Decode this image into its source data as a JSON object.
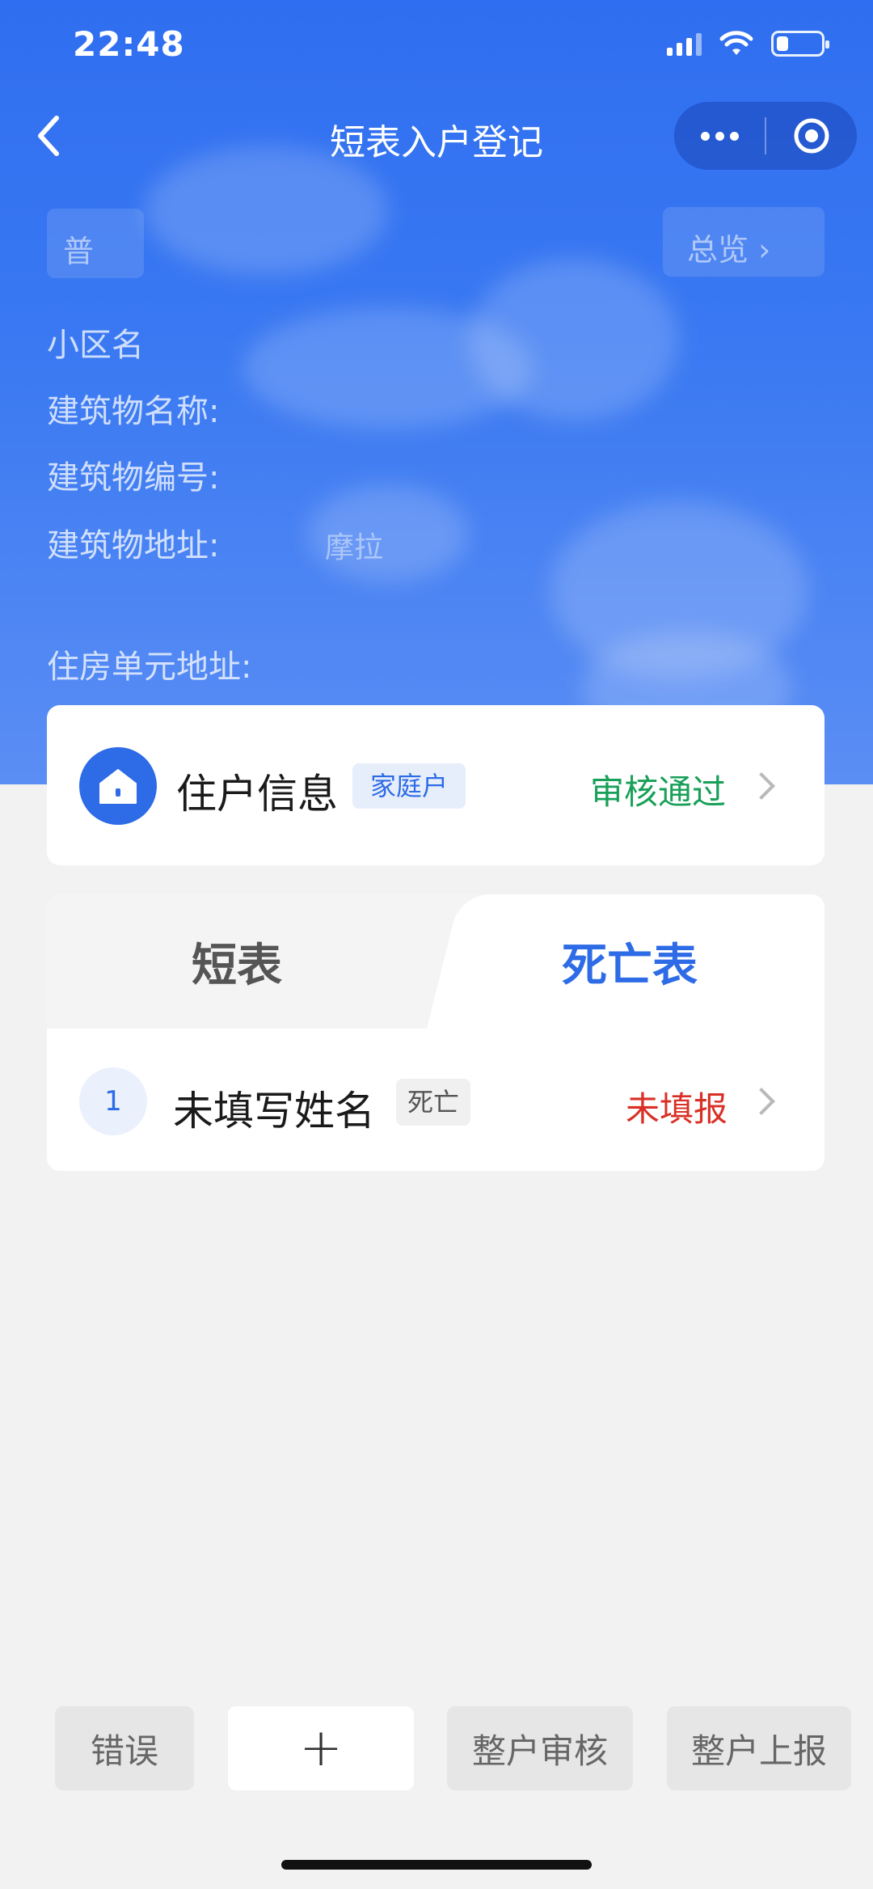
{
  "status_bar": {
    "time": "22:48"
  },
  "nav": {
    "title": "短表入户登记"
  },
  "header": {
    "chip_left": "普",
    "chip_right": "总览 ›",
    "fields": [
      {
        "label": "小区名"
      },
      {
        "label": "建筑物名称:"
      },
      {
        "label": "建筑物编号:"
      },
      {
        "label": "建筑物地址:",
        "value": "摩拉"
      },
      {
        "label": "住房单元地址:"
      }
    ]
  },
  "resident": {
    "title": "住户信息",
    "tag": "家庭户",
    "status": "审核通过"
  },
  "tabs": {
    "short": "短表",
    "death": "死亡表",
    "active": "death"
  },
  "rows": [
    {
      "index": "1",
      "name": "未填写姓名",
      "tag": "死亡",
      "status": "未填报"
    }
  ],
  "bottom_bar": {
    "error": "错误",
    "add": "+",
    "review": "整户审核",
    "submit": "整户上报"
  },
  "colors": {
    "primary": "#2e6be6",
    "pass": "#18a058",
    "unfilled": "#d93026",
    "header_gradient_top": "#2f6ef0"
  }
}
